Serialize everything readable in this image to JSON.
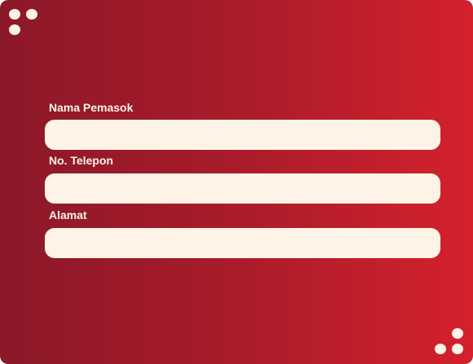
{
  "form": {
    "fields": [
      {
        "label": "Nama Pemasok",
        "value": "",
        "placeholder": ""
      },
      {
        "label": "No. Telepon",
        "value": "",
        "placeholder": ""
      },
      {
        "label": "Alamat",
        "value": "",
        "placeholder": ""
      }
    ]
  },
  "colors": {
    "gradient_start": "#8b1829",
    "gradient_end": "#d4212c",
    "field_bg": "#fdf3e7"
  }
}
